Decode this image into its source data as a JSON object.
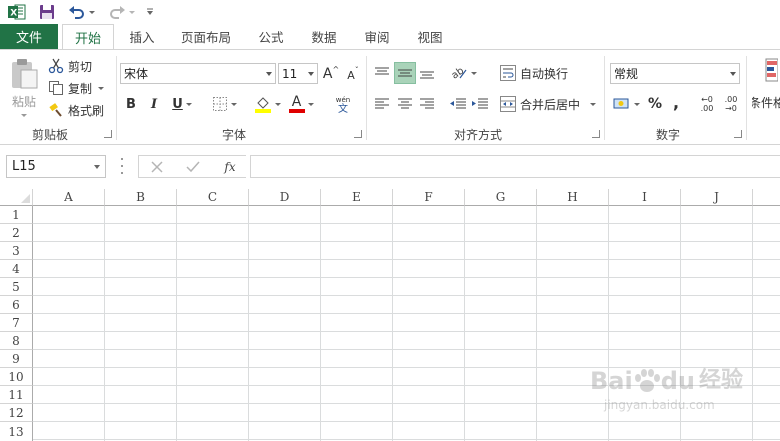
{
  "quick_access": {
    "app_icon": "excel-logo-icon",
    "save_icon": "save-icon",
    "undo_icon": "undo-icon",
    "redo_icon": "redo-icon",
    "customize_icon": "customize-qat-icon"
  },
  "tabs": {
    "file": "文件",
    "items": [
      "开始",
      "插入",
      "页面布局",
      "公式",
      "数据",
      "审阅",
      "视图"
    ]
  },
  "ribbon": {
    "clipboard": {
      "paste_label": "粘贴",
      "cut_label": "剪切",
      "copy_label": "复制",
      "format_painter_label": "格式刷",
      "group_label": "剪贴板"
    },
    "font": {
      "font_name": "宋体",
      "font_size": "11",
      "bold": "B",
      "italic": "I",
      "underline": "U",
      "grow": "A",
      "shrink": "A",
      "phonetic_top": "wén",
      "phonetic_bottom": "文",
      "font_color_letter": "A",
      "group_label": "字体",
      "highlight_color": "#ffff00",
      "font_color": "#e00000"
    },
    "alignment": {
      "wrap_text_label": "自动换行",
      "merge_center_label": "合并后居中",
      "group_label": "对齐方式"
    },
    "number": {
      "format_value": "常规",
      "percent": "%",
      "comma": ",",
      "inc_decimal_top": "←0",
      "inc_decimal_bottom": ".00",
      "dec_decimal_top": ".00",
      "dec_decimal_bottom": "→0",
      "group_label": "数字"
    },
    "styles": {
      "conditional_label": "条件格"
    }
  },
  "formula_bar": {
    "name_box": "L15",
    "fx_label": "fx",
    "formula_value": ""
  },
  "grid": {
    "columns": [
      "A",
      "B",
      "C",
      "D",
      "E",
      "F",
      "G",
      "H",
      "I",
      "J"
    ],
    "rows": [
      "1",
      "2",
      "3",
      "4",
      "5",
      "6",
      "7",
      "8",
      "9",
      "10",
      "11",
      "12",
      "13"
    ]
  },
  "colors": {
    "accent": "#217346",
    "selected_align": "#a9d3b9"
  },
  "watermark": {
    "line1": "Bai",
    "line1b": "du",
    "line1c": "经验",
    "line2": "jingyan.baidu.com"
  }
}
